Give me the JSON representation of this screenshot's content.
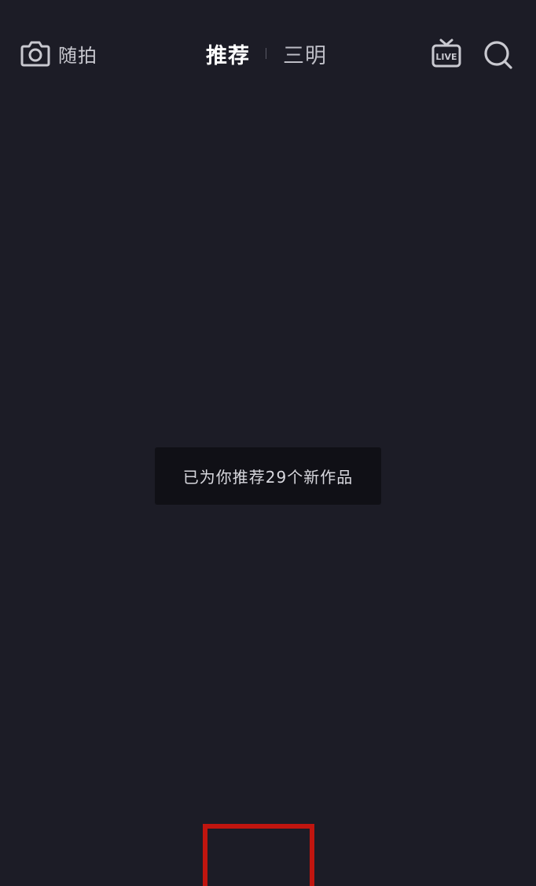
{
  "header": {
    "camera_label": "随拍",
    "tabs": [
      {
        "label": "推荐",
        "active": true
      },
      {
        "label": "三明",
        "active": false
      }
    ],
    "live_badge": "LIVE"
  },
  "toast": {
    "message": "已为你推荐29个新作品"
  },
  "colors": {
    "background": "#1c1c26",
    "toast_bg": "#101016",
    "highlight": "#c0150f"
  },
  "icons": [
    "camera-icon",
    "live-tv-icon",
    "search-icon"
  ]
}
